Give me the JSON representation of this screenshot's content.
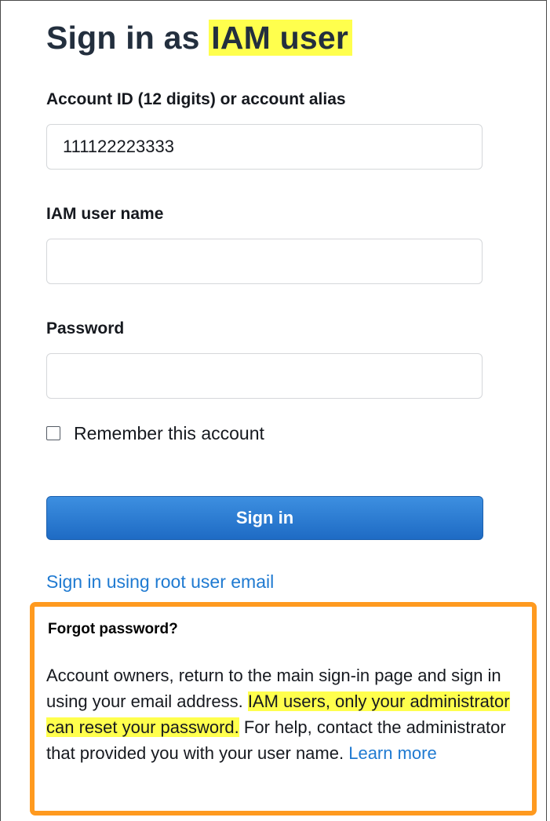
{
  "page": {
    "title_prefix": "Sign in as",
    "title_highlight": "IAM user"
  },
  "form": {
    "account_label": "Account ID (12 digits) or account alias",
    "account_value": "111122223333",
    "username_label": "IAM user name",
    "username_value": "",
    "password_label": "Password",
    "password_value": "",
    "remember_label": "Remember this account",
    "remember_checked": false,
    "signin_button": "Sign in",
    "root_link": "Sign in using root user email"
  },
  "forgot": {
    "title": "Forgot password?",
    "text_before": "Account owners, return to the main sign-in page and sign in using your email address.",
    "text_highlight": "IAM users, only your administrator can reset your password.",
    "text_after": "For help, contact the administrator that provided you with your user name.",
    "learn_more": "Learn more"
  },
  "colors": {
    "highlight": "#ffff4d",
    "callout_border": "#ff9a1f",
    "button_primary": "#1e6bc4",
    "link": "#1f7ad1"
  }
}
